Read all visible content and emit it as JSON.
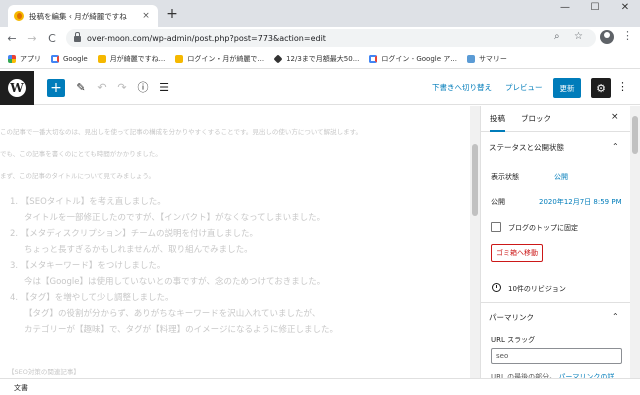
{
  "browser": {
    "tab_title": "投稿を編集 ‹ 月が綺麗ですね",
    "tab_close": "×",
    "new_tab": "+",
    "window_controls": [
      "—",
      "☐",
      "✕"
    ],
    "url": "over-moon.com/wp-admin/post.php?post=773&action=edit",
    "nav": {
      "back": "←",
      "forward": "→",
      "reload": "C"
    },
    "omnibox_icons": {
      "search": "⌕",
      "star": "☆"
    },
    "menu": "⋮"
  },
  "bookmarks": [
    {
      "label": "アプリ",
      "icon": "apps-icon"
    },
    {
      "label": "Google",
      "icon": "google-icon"
    },
    {
      "label": "月が綺麗ですね...",
      "icon": "moon-icon"
    },
    {
      "label": "ログイン・月が綺麗で...",
      "icon": "moon-icon"
    },
    {
      "label": "12/3まで月額最大50...",
      "icon": "diamond-icon"
    },
    {
      "label": "ログイン - Google ア...",
      "icon": "google-icon"
    },
    {
      "label": "サマリー",
      "icon": "cloud-icon"
    }
  ],
  "editor_toolbar": {
    "logo": "W",
    "add": "+",
    "pen": "✎",
    "undo": "↶",
    "redo": "↷",
    "info": "ⓘ",
    "outline": "☰",
    "switch_to_draft": "下書きへ切り替え",
    "preview": "プレビュー",
    "update": "更新",
    "settings": "⚙",
    "more": "⋮"
  },
  "content": {
    "faded_lines": [
      "この記事で一番大切なのは、見出しを使って記事の構成を分かりやすくすることです。見出しの使い方について解説します。",
      "でも、この記事を書くのにとても時間がかかりました。",
      "まず、この記事のタイトルについて見てみましょう。"
    ],
    "list": [
      {
        "text": "1. 【SEOタイトル】を考え直しました。",
        "sub": "タイトルを一部修正したのですが、【インパクト】がなくなってしまいました。"
      },
      {
        "text": "2. 【メタディスクリプション】チームの説明を付け直しました。",
        "sub": "ちょっと長すぎるかもしれませんが、取り組んでみました。"
      },
      {
        "text": "3. 【メタキーワード】をつけしました。",
        "sub": "今は【Google】は使用していないとの事ですが、念のためつけておきました。"
      },
      {
        "text": "4. 【タグ】を増やして少し調整しました。",
        "sub": "【タグ】の役割が分からず、ありがちなキーワードを沢山入れていましたが、"
      },
      {
        "text": "",
        "sub": "カテゴリーが【趣味】で、タグが【料理】のイメージになるように修正しました。"
      }
    ],
    "bottom_faded": "【SEO対策の関連記事】"
  },
  "sidebar": {
    "tab_post": "投稿",
    "tab_block": "ブロック",
    "close": "×",
    "status_panel": "ステータスと公開状態",
    "visibility_label": "表示状態",
    "visibility_value": "公開",
    "publish_label": "公開",
    "publish_value": "2020年12月7日 8:59 PM",
    "sticky_label": "ブログのトップに固定",
    "trash": "ゴミ箱へ移動",
    "revisions": "10件のリビジョン",
    "permalink_panel": "パーマリンク",
    "slug_label": "URL スラッグ",
    "slug_value": "seo",
    "slug_help": "URL の最後の部分。",
    "slug_help_link": "パーマリンクの詳",
    "chevron_up": "⌃"
  },
  "footer": {
    "label": "文書"
  }
}
